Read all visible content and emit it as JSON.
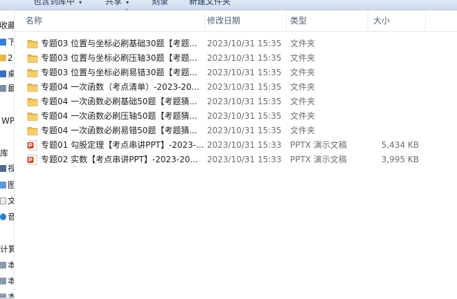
{
  "toolbar": {
    "items": [
      "包含到库中",
      "共享",
      "刻录",
      "新建文件夹"
    ]
  },
  "nav": {
    "items": [
      "收藏",
      "下",
      "2",
      "桌",
      "最",
      "WP",
      "库",
      "视",
      "图",
      "文",
      "音",
      "计算",
      "本",
      "本",
      "本"
    ]
  },
  "columns": {
    "name": "名称",
    "date": "修改日期",
    "type": "类型",
    "size": "大小"
  },
  "files": [
    {
      "icon": "folder-icon",
      "name": "专题03 位置与坐标必刷基础30题【考题...",
      "date": "2023/10/31 15:35",
      "type": "文件夹",
      "size": ""
    },
    {
      "icon": "folder-icon",
      "name": "专题03 位置与坐标必刷压轴30题【考题...",
      "date": "2023/10/31 15:35",
      "type": "文件夹",
      "size": ""
    },
    {
      "icon": "folder-icon",
      "name": "专题03 位置与坐标必刷易错30题【考题...",
      "date": "2023/10/31 15:35",
      "type": "文件夹",
      "size": ""
    },
    {
      "icon": "folder-icon",
      "name": "专题04 一次函数（考点清单）-2023-20...",
      "date": "2023/10/31 15:35",
      "type": "文件夹",
      "size": ""
    },
    {
      "icon": "folder-icon",
      "name": "专题04 一次函数必刷基础50题【考题猜...",
      "date": "2023/10/31 15:35",
      "type": "文件夹",
      "size": ""
    },
    {
      "icon": "folder-icon",
      "name": "专题04 一次函数必刷压轴50题【考题猜...",
      "date": "2023/10/31 15:35",
      "type": "文件夹",
      "size": ""
    },
    {
      "icon": "folder-icon",
      "name": "专题04 一次函数必刷易错50题【考题猜...",
      "date": "2023/10/31 15:35",
      "type": "文件夹",
      "size": ""
    },
    {
      "icon": "pptx-icon",
      "name": "专题01 勾股定理【考点串讲PPT】-2023-...",
      "date": "2023/10/31 15:33",
      "type": "PPTX 演示文稿",
      "size": "5,434 KB"
    },
    {
      "icon": "pptx-icon",
      "name": "专题02 实数【考点串讲PPT】-2023-20...",
      "date": "2023/10/31 15:33",
      "type": "PPTX 演示文稿",
      "size": "3,995 KB"
    }
  ],
  "colors": {
    "folder": "#e8b84a",
    "pptx": "#d24726",
    "header_text": "#4c607a"
  }
}
